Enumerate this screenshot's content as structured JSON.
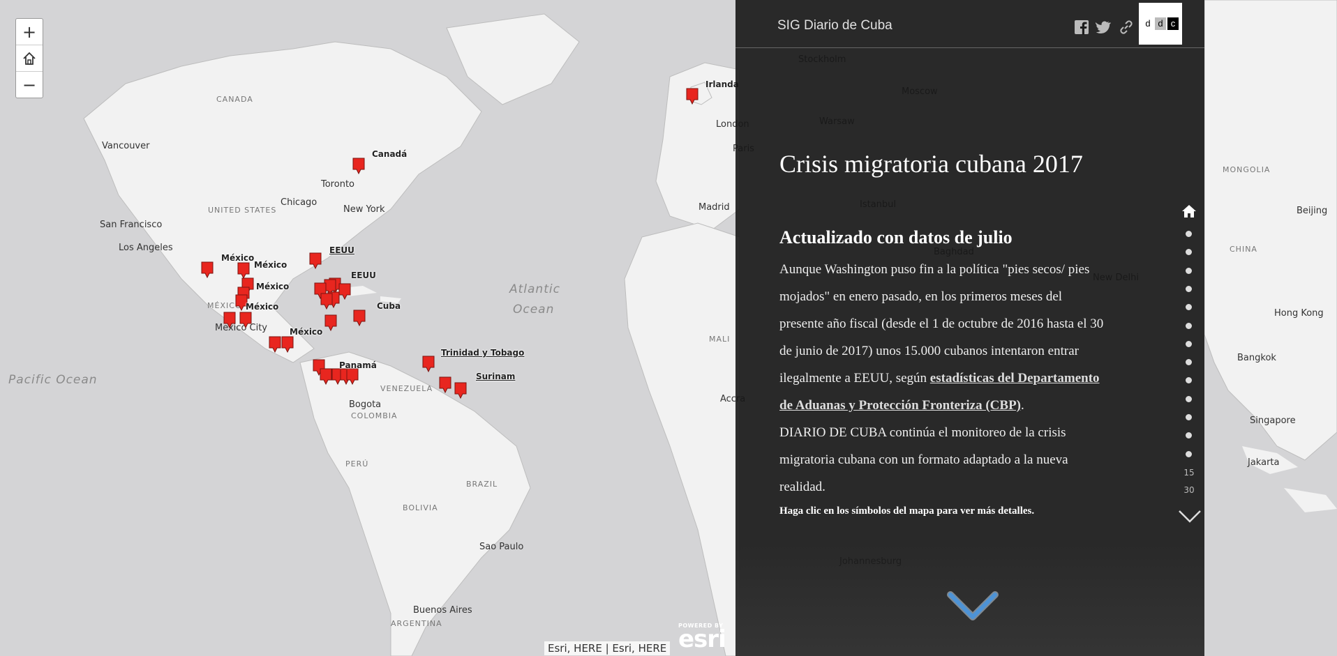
{
  "map": {
    "zoom_in_label": "+",
    "zoom_out_label": "−",
    "attribution": "Esri, HERE | Esri, HERE",
    "esri_powered": "POWERED BY",
    "esri_name": "esri",
    "places": [
      {
        "text": "CANADA",
        "cls": "country"
      },
      {
        "text": "Vancouver",
        "cls": ""
      },
      {
        "text": "Toronto",
        "cls": ""
      },
      {
        "text": "Chicago",
        "cls": ""
      },
      {
        "text": "New York",
        "cls": ""
      },
      {
        "text": "UNITED STATES",
        "cls": "country"
      },
      {
        "text": "San Francisco",
        "cls": ""
      },
      {
        "text": "Los Angeles",
        "cls": ""
      },
      {
        "text": "MÉXICO",
        "cls": "country"
      },
      {
        "text": "Mexico City",
        "cls": ""
      },
      {
        "text": "Atlantic",
        "cls": "ocean"
      },
      {
        "text": "Ocean",
        "cls": "ocean"
      },
      {
        "text": "Pacific Ocean",
        "cls": "ocean"
      },
      {
        "text": "Bogota",
        "cls": ""
      },
      {
        "text": "VENEZUELA",
        "cls": "country"
      },
      {
        "text": "COLOMBIA",
        "cls": "country"
      },
      {
        "text": "PERÚ",
        "cls": "country"
      },
      {
        "text": "BRAZIL",
        "cls": "country"
      },
      {
        "text": "BOLIVIA",
        "cls": "country"
      },
      {
        "text": "Sao Paulo",
        "cls": ""
      },
      {
        "text": "Buenos Aires",
        "cls": ""
      },
      {
        "text": "ARGENTINA",
        "cls": "country"
      },
      {
        "text": "London",
        "cls": ""
      },
      {
        "text": "Paris",
        "cls": ""
      },
      {
        "text": "Madrid",
        "cls": ""
      },
      {
        "text": "Istanbul",
        "cls": ""
      },
      {
        "text": "Moscow",
        "cls": ""
      },
      {
        "text": "Stockholm",
        "cls": ""
      },
      {
        "text": "Warsaw",
        "cls": ""
      },
      {
        "text": "Baghdad",
        "cls": ""
      },
      {
        "text": "New Delhi",
        "cls": ""
      },
      {
        "text": "Accra",
        "cls": ""
      },
      {
        "text": "Johannesburg",
        "cls": ""
      },
      {
        "text": "MONGOLIA",
        "cls": "country"
      },
      {
        "text": "CHINA",
        "cls": "country"
      },
      {
        "text": "Beijing",
        "cls": ""
      },
      {
        "text": "Hong Kong",
        "cls": ""
      },
      {
        "text": "Bangkok",
        "cls": ""
      },
      {
        "text": "Singapore",
        "cls": ""
      },
      {
        "text": "Jakarta",
        "cls": ""
      },
      {
        "text": "MALI",
        "cls": "country"
      }
    ],
    "pin_labels": [
      {
        "text": "Irlanda",
        "u": false
      },
      {
        "text": "Canadá",
        "u": false
      },
      {
        "text": "EEUU",
        "u": true
      },
      {
        "text": "EEUU",
        "u": false
      },
      {
        "text": "México",
        "u": false
      },
      {
        "text": "México",
        "u": false
      },
      {
        "text": "México",
        "u": false
      },
      {
        "text": "México",
        "u": false
      },
      {
        "text": "México",
        "u": false
      },
      {
        "text": "Cuba",
        "u": false
      },
      {
        "text": "Trinidad y Tobago",
        "u": true
      },
      {
        "text": "Surinam",
        "u": true
      },
      {
        "text": "Panamá",
        "u": false
      }
    ],
    "pin_color": "#e8261f"
  },
  "panel": {
    "title": "SIG Diario de Cuba",
    "logo_letters": [
      "d",
      "d",
      "c"
    ],
    "story_title": "Crisis migratoria cubana 2017",
    "subtitle": "Actualizado con datos de julio",
    "body_1": "Aunque Washington puso fin a la política \"pies secos/ pies mojados\" en enero pasado, en los primeros meses del presente año fiscal (desde el 1 de octubre de 2016 hasta el 30 de junio de 2017) unos 15.000 cubanos intentaron entrar ilegalmente a EEUU, según ",
    "body_link": "estadísticas del Departamento de Aduanas y Protección Fronteriza (CBP)",
    "body_2": ".",
    "body_3": "DIARIO DE CUBA continúa el monitoreo de la crisis migratoria cubana con un formato adaptado a la nueva realidad.",
    "hint": "Haga clic en los símbolos del mapa para ver más detalles.",
    "nav_numbers": [
      "15",
      "30"
    ],
    "nav_dot_count": 13
  }
}
